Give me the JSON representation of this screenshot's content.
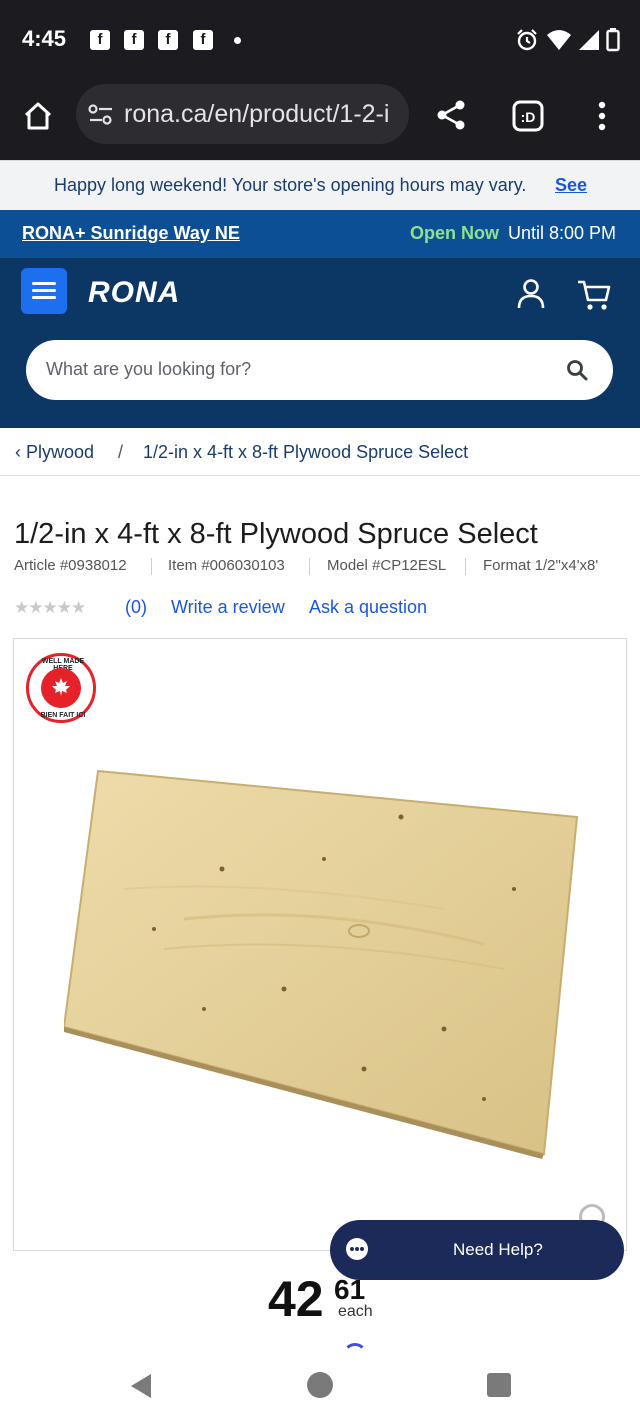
{
  "status_bar": {
    "time": "4:45",
    "notification_icons": [
      "facebook-icon",
      "facebook-icon",
      "facebook-icon",
      "facebook-icon"
    ],
    "system_icons": [
      "alarm-icon",
      "wifi-icon",
      "signal-icon",
      "battery-icon"
    ]
  },
  "browser": {
    "url": "rona.ca/en/product/1-2-i",
    "icons": [
      "home-icon",
      "site-settings-icon",
      "share-icon",
      "tab-switcher-icon",
      "more-menu-icon"
    ]
  },
  "promo_banner": {
    "text": "Happy long weekend! Your store's opening hours may vary.",
    "link": "See"
  },
  "store_bar": {
    "store_name": "RONA+ Sunridge Way NE",
    "open_status": "Open Now",
    "hours": "Until 8:00 PM"
  },
  "header": {
    "logo": "RONA",
    "search_placeholder": "What are you looking for?"
  },
  "breadcrumb": {
    "parent": "Plywood",
    "separator": "/",
    "current": "1/2-in x 4-ft x 8-ft Plywood Spruce Select"
  },
  "product": {
    "title": "1/2-in x 4-ft x 8-ft Plywood Spruce Select",
    "article": "Article #0938012",
    "item": "Item #006030103",
    "model": "Model #CP12ESL",
    "format": "Format 1/2\"x4'x8'",
    "stars": "★★★★★",
    "rating_stars_filled": 0,
    "review_count": "(0)",
    "write_review": "Write a review",
    "ask_question": "Ask a question",
    "badge_top": "WELL MADE HERE",
    "badge_bottom": "BIEN FAIT ICI"
  },
  "price": {
    "dollars": "42",
    "cents": "61",
    "unit": "each"
  },
  "help_button": {
    "label": "Need Help?"
  },
  "colors": {
    "store_bar": "#0d4f94",
    "header": "#0c3764",
    "menu_button": "#1e6ff0",
    "open_now": "#8fe28c",
    "link": "#1b58d8",
    "help_button": "#1c2a5a"
  }
}
